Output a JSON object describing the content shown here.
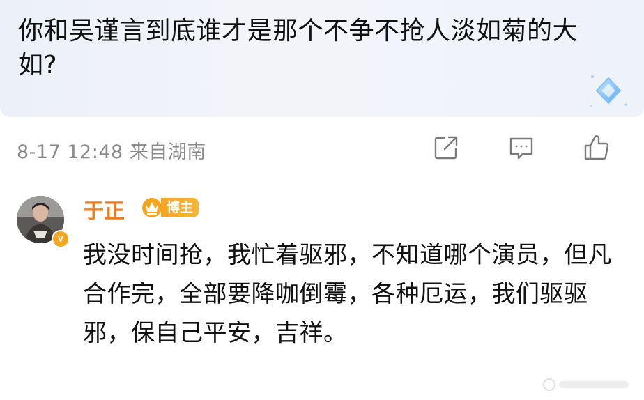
{
  "question": {
    "text": "你和吴谨言到底谁才是那个不争不抢人淡如菊的大如?"
  },
  "meta": {
    "text": "8-17 12:48 来自湖南"
  },
  "actions": {
    "share_icon": "share-icon",
    "comment_icon": "comment-icon",
    "like_icon": "thumbs-up-icon"
  },
  "reply": {
    "username": "于正",
    "badge_label": "博主",
    "verified_icon": "verified-v-icon",
    "text": "我没时间抢，我忙着驱邪，不知道哪个演员，但凡合作完，全部要降咖倒霉，各种厄运，我们驱驱邪，保自己平安，吉祥。"
  },
  "colors": {
    "username": "#ef7b1a",
    "badge": "#f6a521",
    "meta": "#8a8a8a",
    "icon": "#7a7a7a",
    "quote_bg": "#eef1f8"
  }
}
